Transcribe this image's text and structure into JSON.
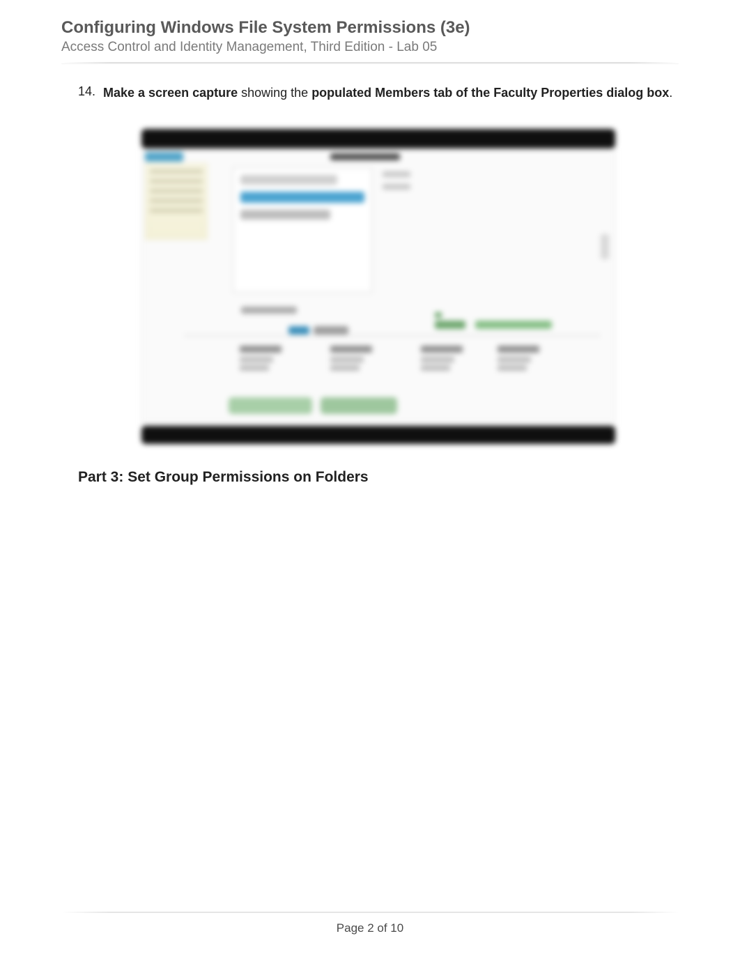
{
  "header": {
    "title": "Configuring Windows File System Permissions (3e)",
    "subtitle": "Access Control and Identity Management, Third Edition - Lab 05"
  },
  "step": {
    "number": "14.",
    "bold_lead": "Make a screen capture",
    "mid": " showing the ",
    "bold_tail": "populated Members tab of the Faculty Properties dialog box",
    "period": "."
  },
  "section_heading": "Part 3: Set Group Permissions on Folders",
  "footer": {
    "page_label": "Page 2 of 10"
  }
}
